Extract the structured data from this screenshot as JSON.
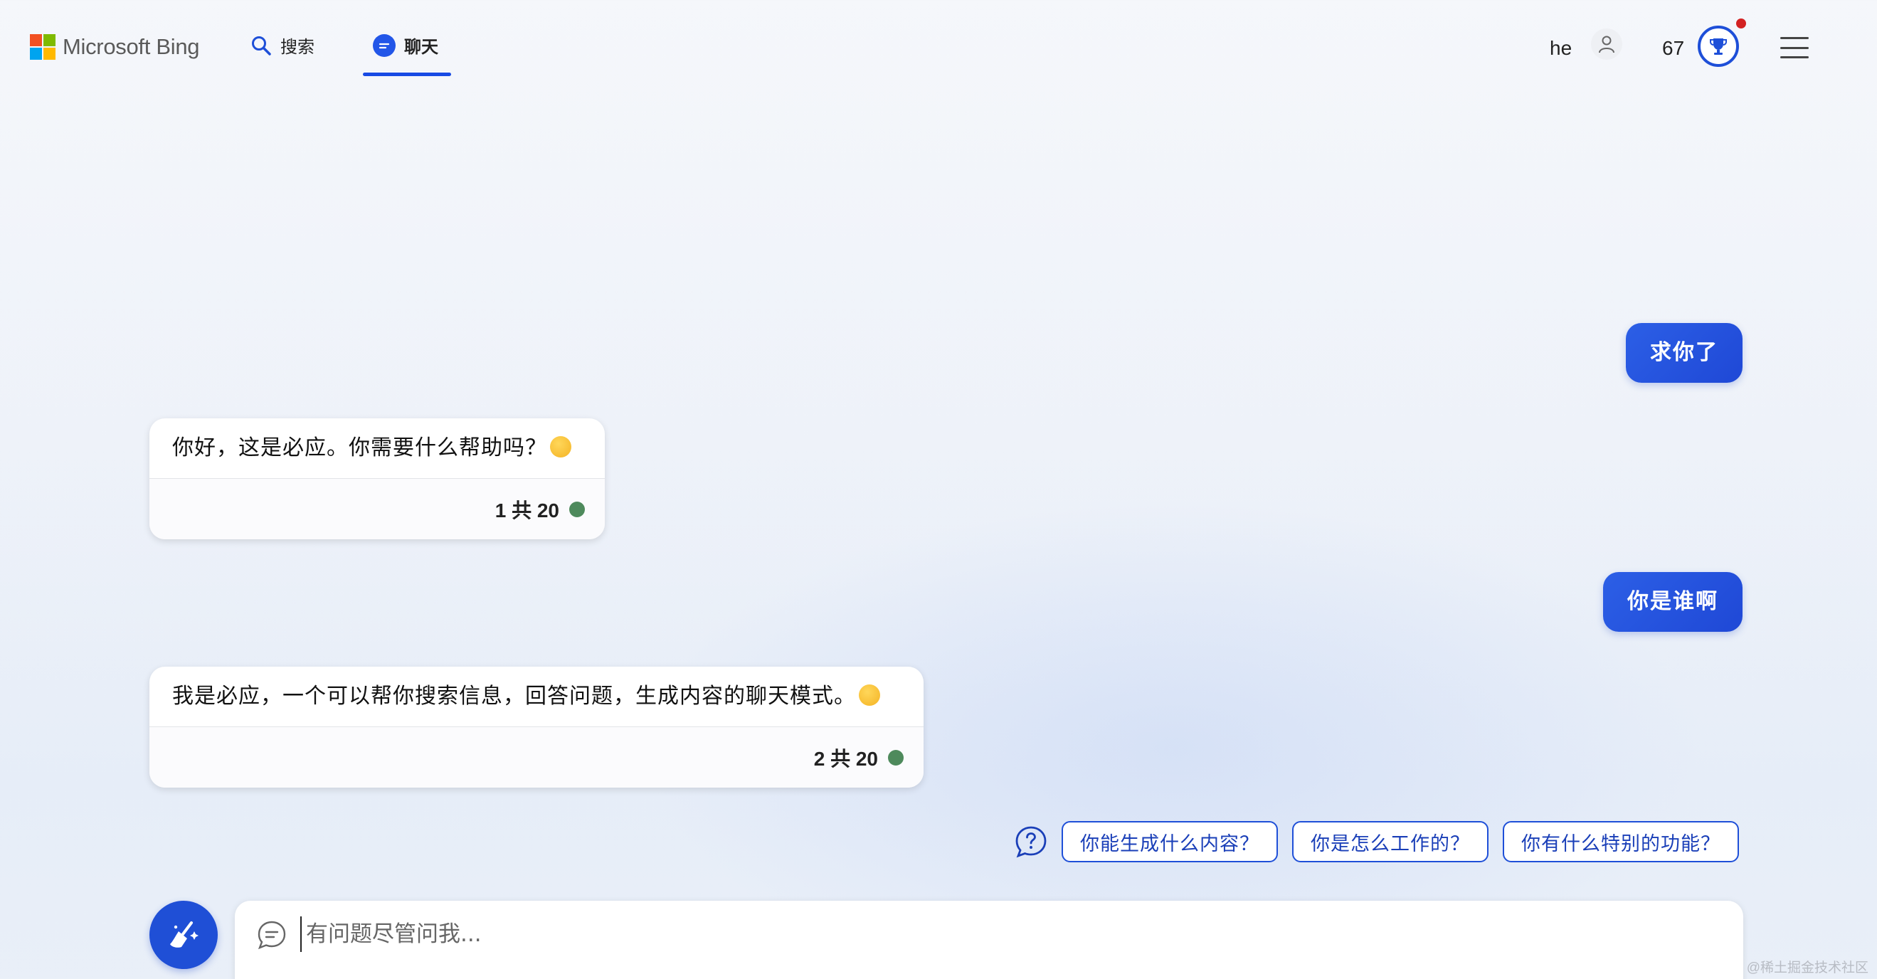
{
  "header": {
    "brand": "Microsoft Bing",
    "logo_colors": [
      "#f25022",
      "#7fba00",
      "#00a4ef",
      "#ffb900"
    ],
    "tabs": [
      {
        "label": "搜索",
        "icon": "search-icon"
      },
      {
        "label": "聊天",
        "icon": "chat-icon",
        "active": true
      }
    ],
    "user_name": "he",
    "points": "67",
    "accent": "#1e4fd8"
  },
  "messages": [
    {
      "role": "user",
      "text": "求你了"
    },
    {
      "role": "bot",
      "text": "你好，这是必应。你需要什么帮助吗？",
      "counter": "1 共 20"
    },
    {
      "role": "user",
      "text": "你是谁啊"
    },
    {
      "role": "bot",
      "text": "我是必应，一个可以帮你搜索信息，回答问题，生成内容的聊天模式。",
      "counter": "2 共 20"
    }
  ],
  "suggestions": [
    "你能生成什么内容？",
    "你是怎么工作的？",
    "你有什么特别的功能？"
  ],
  "input": {
    "placeholder": "有问题尽管问我..."
  },
  "watermark": "@稀土掘金技术社区"
}
